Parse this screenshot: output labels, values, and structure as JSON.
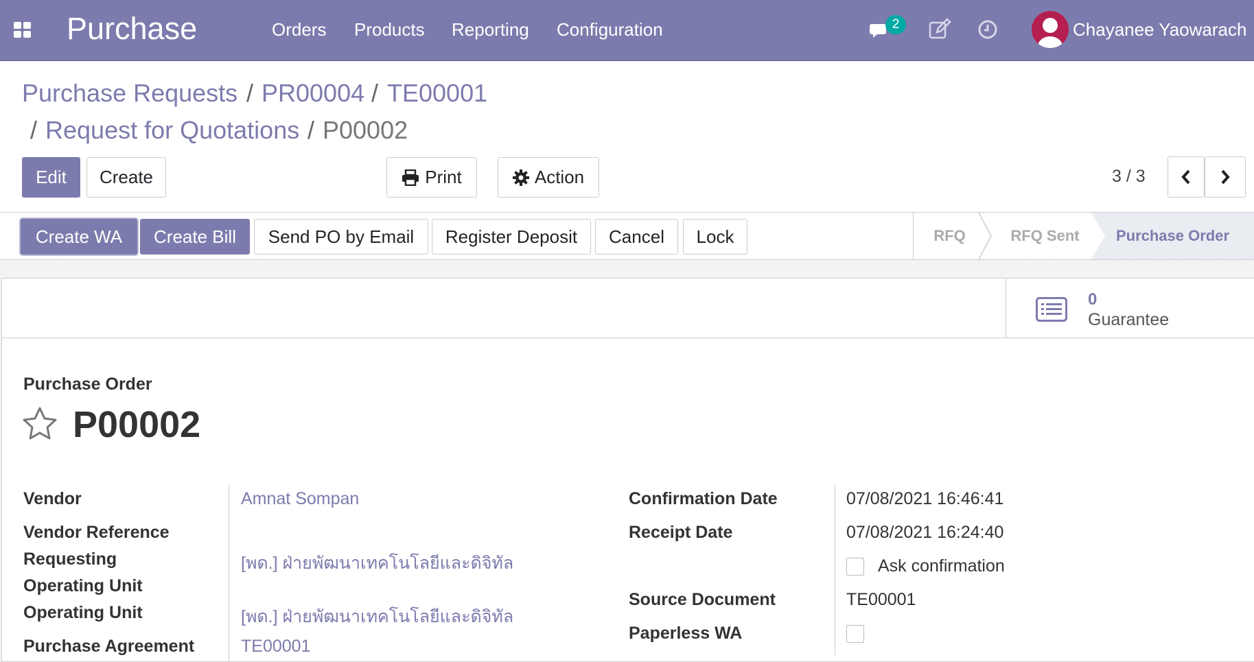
{
  "navbar": {
    "brand": "Purchase",
    "menu": [
      "Orders",
      "Products",
      "Reporting",
      "Configuration"
    ],
    "message_count": "2",
    "user_name": "Chayanee Yaowarach"
  },
  "breadcrumb": {
    "items": [
      "Purchase Requests",
      "PR00004",
      "TE00001",
      "Request for Quotations"
    ],
    "current": "P00002",
    "separator": "/"
  },
  "control": {
    "edit_label": "Edit",
    "create_label": "Create",
    "print_label": "Print",
    "action_label": "Action",
    "pager": "3 / 3"
  },
  "statusbar": {
    "buttons": [
      "Create WA",
      "Create Bill",
      "Send PO by Email",
      "Register Deposit",
      "Cancel",
      "Lock"
    ],
    "annotation_marker": "1",
    "stages": [
      "RFQ",
      "RFQ Sent",
      "Purchase Order"
    ],
    "current_stage": "Purchase Order"
  },
  "smart_button": {
    "count": "0",
    "label": "Guarantee"
  },
  "form": {
    "doc_type": "Purchase Order",
    "name": "P00002",
    "left_fields": [
      {
        "label": "Vendor",
        "value": "Amnat Sompan"
      },
      {
        "label": "Vendor Reference",
        "value": ""
      },
      {
        "label": "Requesting",
        "value": "[พด.] ฝ่ายพัฒนาเทคโนโลยีและดิจิทัล"
      },
      {
        "label": "Operating Unit",
        "value": ""
      },
      {
        "label": "Operating Unit",
        "value": "[พด.] ฝ่ายพัฒนาเทคโนโลยีและดิจิทัล"
      },
      {
        "label": "Purchase Agreement",
        "value": "TE00001"
      }
    ],
    "right_fields": [
      {
        "label": "Confirmation Date",
        "value": "07/08/2021 16:46:41"
      },
      {
        "label": "Receipt Date",
        "value": "07/08/2021 16:24:40"
      },
      {
        "label": "",
        "value": "Ask confirmation"
      },
      {
        "label": "Source Document",
        "value": "TE00001"
      },
      {
        "label": "Paperless WA",
        "value": ""
      }
    ]
  },
  "colors": {
    "brand": "#7c7bad",
    "badge": "#01a9a4",
    "annotation": "#e0141e"
  }
}
